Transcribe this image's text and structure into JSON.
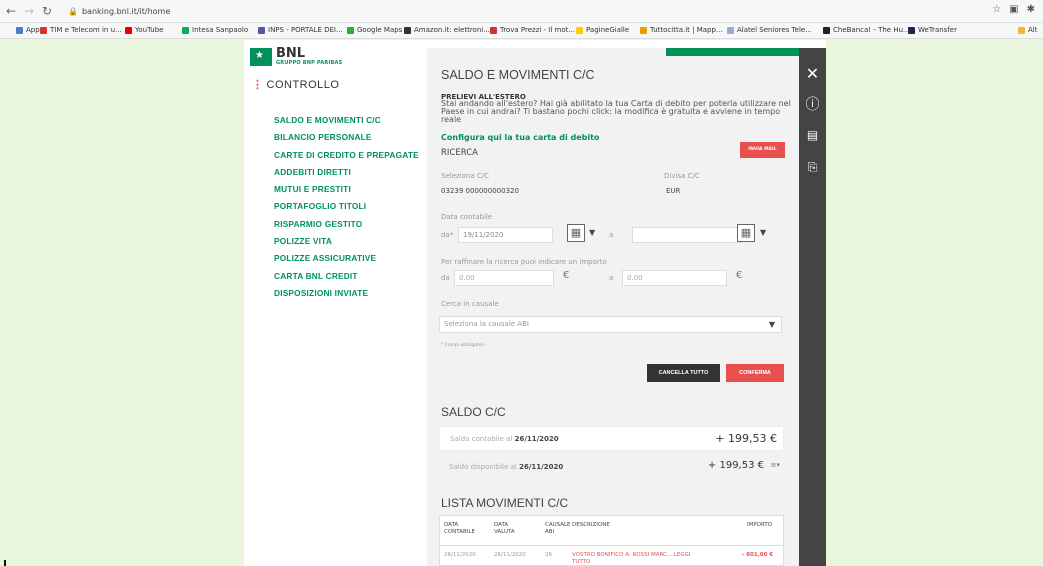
{
  "browser": {
    "back_icon": "arrow-left-icon",
    "url": "banking.bnl.it/it/home",
    "bookmarks": [
      "App",
      "TIM e Telecom in u...",
      "YouTube",
      "Intesa Sanpaolo",
      "INPS - PORTALE DEI...",
      "Google Maps",
      "Amazon.it: elettroni...",
      "Trova Prezzi - Il mot...",
      "PagineGialle",
      "Tuttocitta.it | Mapp...",
      "Alatel Seniores Tele...",
      "CheBanca! - The Hu...",
      "WeTransfer",
      "Alt"
    ]
  },
  "logo": {
    "name": "BNL",
    "sub": "GRUPPO BNP PARIBAS"
  },
  "controllo": "CONTROLLO",
  "menu": [
    "SALDO E MOVIMENTI C/C",
    "BILANCIO PERSONALE",
    "CARTE DI CREDITO E PREPAGATE",
    "ADDEBITI DIRETTI",
    "MUTUI E PRESTITI",
    "PORTAFOGLIO TITOLI",
    "RISPARMIO GESTITO",
    "POLIZZE VITA",
    "POLIZZE ASSICURATIVE",
    "CARTA BNL CREDIT",
    "DISPOSIZIONI INVIATE"
  ],
  "panel": {
    "title": "SALDO E MOVIMENTI C/C",
    "info_title": "PRELIEVI ALL'ESTERO",
    "info_text": "Stai andando all'estero? Hai già abilitato la tua Carta di debito per poterla utilizzare nel Paese in cui andrai? Ti bastano pochi click: la modifica è gratuita e avviene in tempo reale",
    "info_link": "Configura qui la tua carta di debito",
    "ricerca": "RICERCA",
    "invia_btn": "INVIA MAIL",
    "seleziona_label": "Seleziona C/C",
    "seleziona_value": "03239 000000000320",
    "divisa_label": "Divisa C/C",
    "divisa_value": "EUR",
    "data_label": "Data contabile",
    "da_label": "da*",
    "da_value": "19/11/2020",
    "a_label": "a",
    "importo_label": "Per raffinare la ricerca puoi indicare un importo",
    "importo_da_label": "da",
    "importo_da": "0.00",
    "importo_a_label": "a",
    "importo_a": "0.00",
    "euro": "€",
    "causale_label": "Cerca in causale",
    "causale_placeholder": "Seleziona la causale ABI",
    "obbligatori": "* Campi obbligatori",
    "cancella_btn": "CANCELLA TUTTO",
    "conferma_btn": "CONFERMA",
    "saldo_title": "SALDO C/C",
    "saldo_contabile_label": "Saldo contabile al",
    "saldo_contabile_date": "26/11/2020",
    "saldo_contabile_amount": "+ 199,53 €",
    "saldo_disponibile_label": "Saldo disponibile al",
    "saldo_disponibile_date": "26/11/2020",
    "saldo_disponibile_amount": "+ 199,53 €",
    "lista_title": "LISTA MOVIMENTI C/C",
    "table_headers": [
      "DATA CONTABILE",
      "DATA VALUTA",
      "CAUSALE ABI",
      "DESCRIZIONE",
      "IMPORTO"
    ],
    "row": {
      "data_contabile": "26/11/2020",
      "data_valuta": "26/11/2020",
      "causale": "26",
      "descrizione": "VOSTRO BONIFICO A: ROSSI MARC... LEGGI TUTTO",
      "importo": "- 601,00 €"
    }
  },
  "sidebar_icons": [
    "close-icon",
    "help-icon",
    "print-icon",
    "export-icon"
  ],
  "colors": {
    "green": "#00915a",
    "red": "#e85050",
    "sidebar": "#444444"
  }
}
